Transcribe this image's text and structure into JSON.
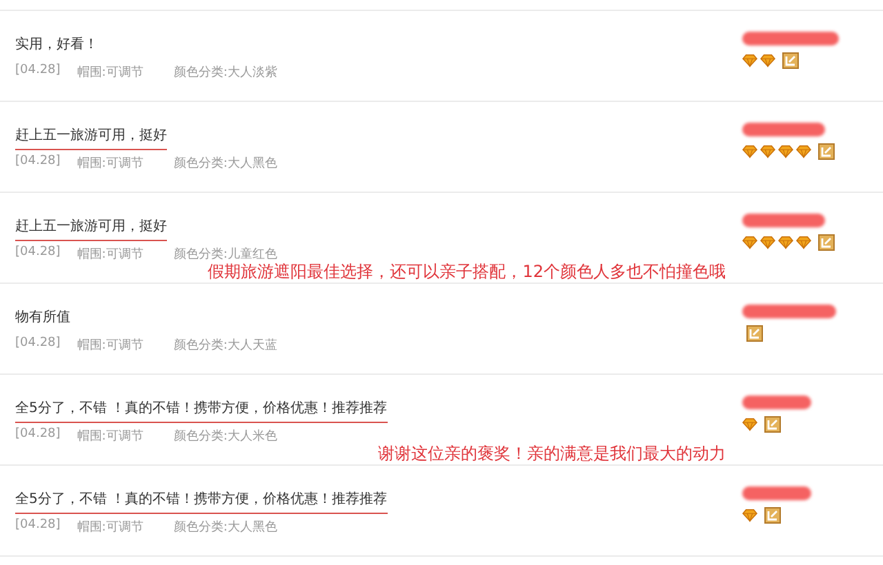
{
  "reviews": [
    {
      "text": "实用，好看！",
      "underlined": false,
      "date": "[04.28]",
      "size": "帽围:可调节",
      "color_category": "颜色分类:大人淡紫",
      "rank_icons": [
        {
          "kind": "diamond"
        },
        {
          "kind": "diamond"
        },
        {
          "kind": "badge"
        }
      ]
    },
    {
      "text": "赶上五一旅游可用，挺好",
      "underlined": true,
      "date": "[04.28]",
      "size": "帽围:可调节",
      "color_category": "颜色分类:大人黑色",
      "rank_icons": [
        {
          "kind": "diamond"
        },
        {
          "kind": "diamond"
        },
        {
          "kind": "diamond"
        },
        {
          "kind": "diamond"
        },
        {
          "kind": "badge"
        }
      ]
    },
    {
      "text": "赶上五一旅游可用，挺好",
      "underlined": true,
      "date": "[04.28]",
      "size": "帽围:可调节",
      "color_category": "颜色分类:儿童红色",
      "rank_icons": [
        {
          "kind": "diamond"
        },
        {
          "kind": "diamond"
        },
        {
          "kind": "diamond"
        },
        {
          "kind": "diamond"
        },
        {
          "kind": "badge"
        }
      ],
      "annotation": "假期旅游遮阳最佳选择，还可以亲子搭配，12个颜色人多也不怕撞色哦"
    },
    {
      "text": "物有所值",
      "underlined": false,
      "date": "[04.28]",
      "size": "帽围:可调节",
      "color_category": "颜色分类:大人天蓝",
      "rank_icons": [
        {
          "kind": "badge"
        }
      ]
    },
    {
      "text": "全5分了，不错 ！真的不错！携带方便，价格优惠！推荐推荐",
      "underlined": true,
      "date": "[04.28]",
      "size": "帽围:可调节",
      "color_category": "颜色分类:大人米色",
      "rank_icons": [
        {
          "kind": "diamond"
        },
        {
          "kind": "badge"
        }
      ],
      "annotation": "谢谢这位亲的褒奖！亲的满意是我们最大的动力"
    },
    {
      "text": "全5分了，不错 ！真的不错！携带方便，价格优惠！推荐推荐",
      "underlined": true,
      "date": "[04.28]",
      "size": "帽围:可调节",
      "color_category": "颜色分类:大人黑色",
      "rank_icons": [
        {
          "kind": "diamond"
        },
        {
          "kind": "badge"
        }
      ]
    }
  ]
}
